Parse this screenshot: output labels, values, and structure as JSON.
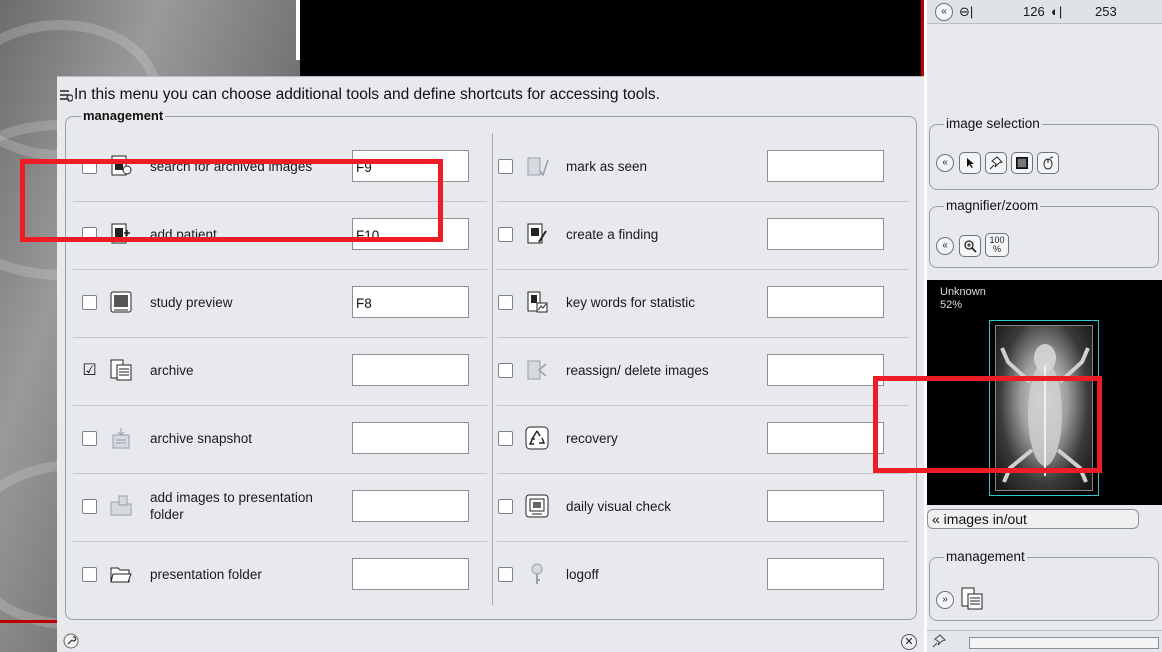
{
  "dialog": {
    "title": "In this menu you can choose additional tools and define shortcuts for accessing tools.",
    "group_label": "management",
    "left_tools": [
      {
        "label": "search for archived images",
        "checked": false,
        "shortcut": "F9",
        "icon": "search-archive-icon"
      },
      {
        "label": "add patient",
        "checked": false,
        "shortcut": "F10",
        "icon": "add-patient-icon"
      },
      {
        "label": "study preview",
        "checked": false,
        "shortcut": "F8",
        "icon": "study-preview-icon"
      },
      {
        "label": "archive",
        "checked": true,
        "shortcut": "",
        "icon": "archive-icon"
      },
      {
        "label": "archive snapshot",
        "checked": false,
        "shortcut": "",
        "icon": "archive-snapshot-icon"
      },
      {
        "label": "add images to presentation folder",
        "checked": false,
        "shortcut": "",
        "icon": "add-to-folder-icon"
      },
      {
        "label": "presentation folder",
        "checked": false,
        "shortcut": "",
        "icon": "presentation-folder-icon"
      }
    ],
    "right_tools": [
      {
        "label": "mark as seen",
        "checked": false,
        "shortcut": "",
        "icon": "mark-seen-icon"
      },
      {
        "label": "create a finding",
        "checked": false,
        "shortcut": "",
        "icon": "create-finding-icon"
      },
      {
        "label": "key words for statistic",
        "checked": false,
        "shortcut": "",
        "icon": "statistic-icon"
      },
      {
        "label": "reassign/ delete images",
        "checked": false,
        "shortcut": "",
        "icon": "reassign-icon"
      },
      {
        "label": "recovery",
        "checked": false,
        "shortcut": "",
        "icon": "recycle-icon"
      },
      {
        "label": "daily visual check",
        "checked": false,
        "shortcut": "",
        "icon": "visual-check-icon"
      },
      {
        "label": "logoff",
        "checked": false,
        "shortcut": "",
        "icon": "key-icon"
      }
    ],
    "check_glyph": "☑",
    "close_glyph": "✕"
  },
  "right_panel": {
    "window_value": "126",
    "level_value": "253",
    "image_selection_label": "image selection",
    "magnifier_label": "magnifier/zoom",
    "zoom_100_label": "100\n%",
    "thumb_caption_line1": "Unknown",
    "thumb_caption_line2": "52%",
    "images_inout_label": "« images in/out",
    "management_label": "management",
    "collapse_glyph": "«",
    "expand_glyph": "»"
  },
  "colors": {
    "annotation": "#ee1c25",
    "dialog_bg": "#e7e9ed",
    "thumbnail_frame": "#33c8d0"
  }
}
